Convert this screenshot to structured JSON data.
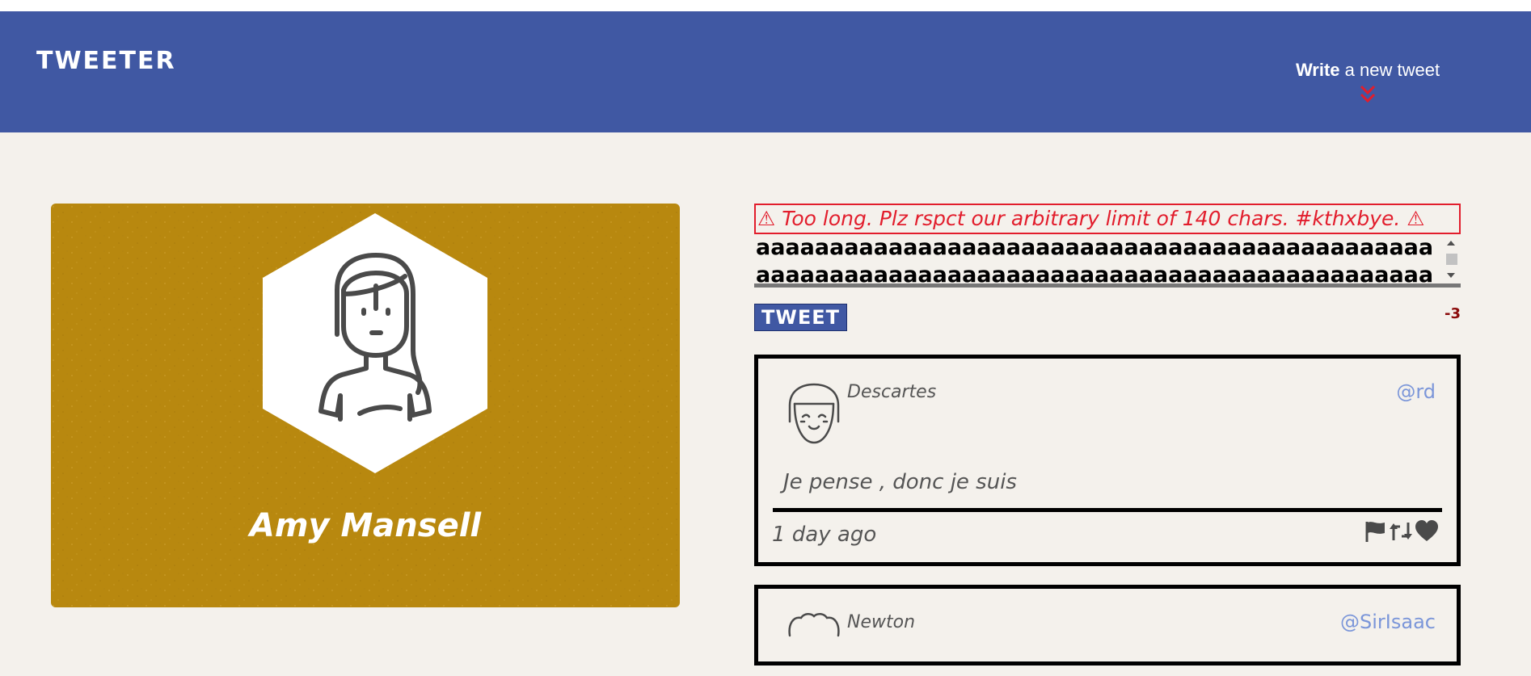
{
  "app": {
    "brand": "TWEETER"
  },
  "nav": {
    "compose_strong": "Write",
    "compose_rest": " a new tweet",
    "chevron_icon": "double-chevron-down-icon"
  },
  "profile": {
    "name": "Amy Mansell",
    "card_color": "#b8880f"
  },
  "compose": {
    "error": "⚠ Too long. Plz rspct our arbitrary limit of 140 chars. #kthxbye. ⚠",
    "text": "aaaaaaaaaaaaaaaaaaaaaaaaaaaaaaaaaaaaaaaaaaaaaaaaaaaaaaaaaaaaaaaaaaaaaaaaaaaaaaaaaaaaaaaaaaaaaaaaaaaaaaaaaaaaaaaaaaaaaaaaaaaaaaaaaaaaaaaaaaa",
    "button_label": "TWEET",
    "counter": "-3"
  },
  "tweets": [
    {
      "author": "Descartes",
      "handle": "@rd",
      "content": "Je pense , donc je suis",
      "time": "1 day ago",
      "actions": [
        "flag-icon",
        "retweet-icon",
        "heart-icon"
      ]
    },
    {
      "author": "Newton",
      "handle": "@SirIsaac"
    }
  ],
  "colors": {
    "nav": "#4058a3",
    "background": "#f4f1ec",
    "error": "#e21d2c",
    "handle": "#7b96d9",
    "counter": "#8b0b0b"
  }
}
